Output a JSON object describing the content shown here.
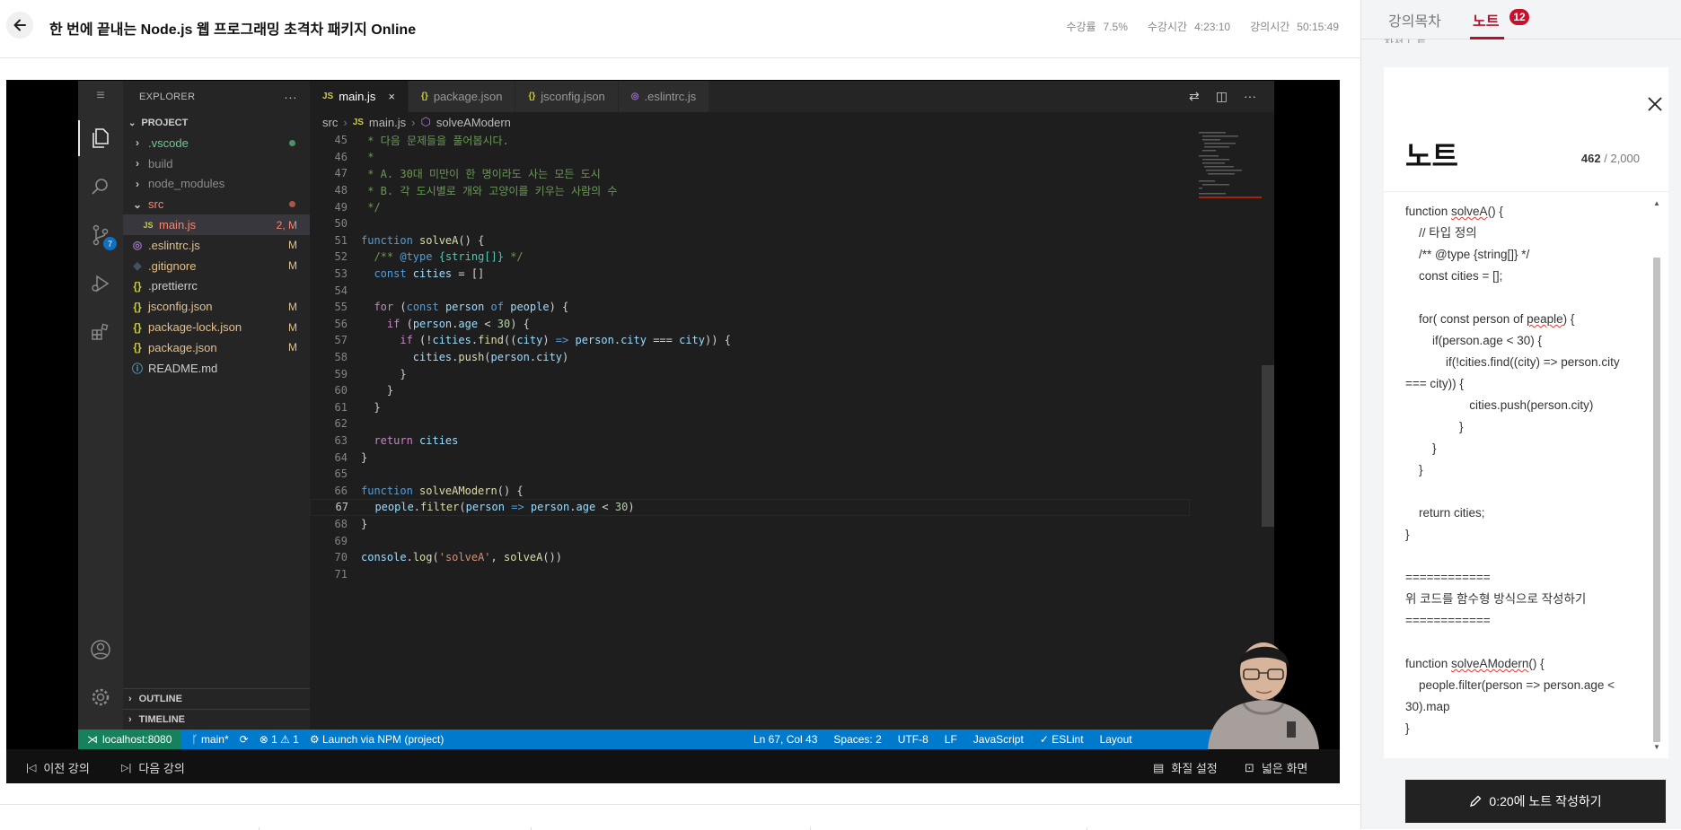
{
  "header": {
    "title": "한 번에 끝내는 Node.js 웹 프로그래밍 초격차 패키지 Online",
    "stats": [
      {
        "label": "수강률",
        "value": "7.5%"
      },
      {
        "label": "수강시간",
        "value": "4:23:10"
      },
      {
        "label": "강의시간",
        "value": "50:15:49"
      }
    ]
  },
  "vscode": {
    "explorer_title": "EXPLORER",
    "explorer_more": "···",
    "project_label": "PROJECT",
    "scm_badge": "7",
    "tree": [
      {
        "name": ".vscode",
        "kind": "folder",
        "indent": 1,
        "color": "#73c991",
        "dot": "#4f8f6a"
      },
      {
        "name": "build",
        "kind": "folder",
        "indent": 1,
        "color": "#8c8c8c"
      },
      {
        "name": "node_modules",
        "kind": "folder",
        "indent": 1,
        "color": "#8c8c8c"
      },
      {
        "name": "src",
        "kind": "folder-open",
        "indent": 1,
        "color": "#f48771",
        "dot": "#a8564a"
      },
      {
        "name": "main.js",
        "kind": "js",
        "indent": 2,
        "color": "#f48771",
        "badge": "2, M",
        "badgeColor": "#f48771",
        "selected": true
      },
      {
        "name": ".eslintrc.js",
        "kind": "eslint",
        "indent": 1,
        "color": "#e2c08d",
        "badge": "M",
        "badgeColor": "#e2c08d"
      },
      {
        "name": ".gitignore",
        "kind": "git",
        "indent": 1,
        "color": "#e2c08d",
        "badge": "M",
        "badgeColor": "#e2c08d"
      },
      {
        "name": ".prettierrc",
        "kind": "json",
        "indent": 1,
        "color": "#cccccc"
      },
      {
        "name": "jsconfig.json",
        "kind": "json",
        "indent": 1,
        "color": "#e2c08d",
        "badge": "M",
        "badgeColor": "#e2c08d"
      },
      {
        "name": "package-lock.json",
        "kind": "json",
        "indent": 1,
        "color": "#e2c08d",
        "badge": "M",
        "badgeColor": "#e2c08d"
      },
      {
        "name": "package.json",
        "kind": "json",
        "indent": 1,
        "color": "#e2c08d",
        "badge": "M",
        "badgeColor": "#e2c08d"
      },
      {
        "name": "README.md",
        "kind": "info",
        "indent": 1,
        "color": "#cccccc"
      }
    ],
    "outline_label": "OUTLINE",
    "timeline_label": "TIMELINE",
    "tabs": [
      {
        "icon": "JS",
        "iconColor": "#cbcb41",
        "label": "main.js",
        "active": true,
        "close": "×"
      },
      {
        "icon": "{}",
        "iconColor": "#cbcb41",
        "label": "package.json"
      },
      {
        "icon": "{}",
        "iconColor": "#cbcb41",
        "label": "jsconfig.json"
      },
      {
        "icon": "◎",
        "iconColor": "#a074c4",
        "label": ".eslintrc.js"
      }
    ],
    "breadcrumb": [
      "src",
      "main.js",
      "solveAModern"
    ],
    "code_lines": [
      {
        "n": 45,
        "segs": [
          [
            "c-com",
            " * 다음 문제들을 풀어봅시다."
          ]
        ]
      },
      {
        "n": 46,
        "segs": [
          [
            "c-com",
            " *"
          ]
        ]
      },
      {
        "n": 47,
        "segs": [
          [
            "c-com",
            " * A. 30대 미만이 한 명이라도 사는 모든 도시"
          ]
        ]
      },
      {
        "n": 48,
        "segs": [
          [
            "c-com",
            " * B. 각 도시별로 개와 고양이를 키우는 사람의 수"
          ]
        ]
      },
      {
        "n": 49,
        "segs": [
          [
            "c-com",
            " */"
          ]
        ]
      },
      {
        "n": 50,
        "segs": []
      },
      {
        "n": 51,
        "segs": [
          [
            "c-kw",
            "function "
          ],
          [
            "c-fn",
            "solveA"
          ],
          [
            "",
            "() {"
          ]
        ]
      },
      {
        "n": 52,
        "segs": [
          [
            "c-com",
            "  /** "
          ],
          [
            "c-kw",
            "@type"
          ],
          [
            "c-com",
            " "
          ],
          [
            "c-typ",
            "{string[]}"
          ],
          [
            "c-com",
            " */"
          ]
        ]
      },
      {
        "n": 53,
        "segs": [
          [
            "c-kw",
            "  const "
          ],
          [
            "c-var",
            "cities"
          ],
          [
            "",
            " = []"
          ]
        ]
      },
      {
        "n": 54,
        "segs": []
      },
      {
        "n": 55,
        "segs": [
          [
            "c-ctl",
            "  for "
          ],
          [
            "",
            "("
          ],
          [
            "c-kw",
            "const "
          ],
          [
            "c-var",
            "person "
          ],
          [
            "c-kw",
            "of "
          ],
          [
            "c-var",
            "people"
          ],
          [
            "",
            ") {"
          ]
        ]
      },
      {
        "n": 56,
        "segs": [
          [
            "c-ctl",
            "    if "
          ],
          [
            "",
            "("
          ],
          [
            "c-var",
            "person"
          ],
          [
            "",
            "."
          ],
          [
            "c-var",
            "age"
          ],
          [
            "",
            " < "
          ],
          [
            "c-num",
            "30"
          ],
          [
            "",
            ") {"
          ]
        ]
      },
      {
        "n": 57,
        "segs": [
          [
            "c-ctl",
            "      if "
          ],
          [
            "",
            "(!"
          ],
          [
            "c-var",
            "cities"
          ],
          [
            "",
            "."
          ],
          [
            "c-fn",
            "find"
          ],
          [
            "",
            "(("
          ],
          [
            "c-var",
            "city"
          ],
          [
            "",
            ") "
          ],
          [
            "c-kw",
            "=>"
          ],
          [
            "",
            " "
          ],
          [
            "c-var",
            "person"
          ],
          [
            "",
            "."
          ],
          [
            "c-var",
            "city"
          ],
          [
            "",
            " === "
          ],
          [
            "c-var",
            "city"
          ],
          [
            "",
            ")) {"
          ]
        ]
      },
      {
        "n": 58,
        "segs": [
          [
            "c-var",
            "        cities"
          ],
          [
            "",
            "."
          ],
          [
            "c-fn",
            "push"
          ],
          [
            "",
            "("
          ],
          [
            "c-var",
            "person"
          ],
          [
            "",
            "."
          ],
          [
            "c-var",
            "city"
          ],
          [
            "",
            ")"
          ]
        ]
      },
      {
        "n": 59,
        "segs": [
          [
            "",
            "      }"
          ]
        ]
      },
      {
        "n": 60,
        "segs": [
          [
            "",
            "    }"
          ]
        ]
      },
      {
        "n": 61,
        "segs": [
          [
            "",
            "  }"
          ]
        ]
      },
      {
        "n": 62,
        "segs": []
      },
      {
        "n": 63,
        "segs": [
          [
            "c-ctl",
            "  return "
          ],
          [
            "c-var",
            "cities"
          ]
        ]
      },
      {
        "n": 64,
        "segs": [
          [
            "",
            "}"
          ]
        ]
      },
      {
        "n": 65,
        "segs": []
      },
      {
        "n": 66,
        "segs": [
          [
            "c-kw",
            "function "
          ],
          [
            "c-fn",
            "solveAModern"
          ],
          [
            "",
            "() {"
          ]
        ]
      },
      {
        "n": 67,
        "segs": [
          [
            "c-var",
            "  people"
          ],
          [
            "",
            "."
          ],
          [
            "c-fn",
            "filter"
          ],
          [
            "",
            "("
          ],
          [
            "c-var",
            "person"
          ],
          [
            "",
            " "
          ],
          [
            "c-kw",
            "=>"
          ],
          [
            "",
            " "
          ],
          [
            "c-var",
            "person"
          ],
          [
            "",
            "."
          ],
          [
            "c-var",
            "age"
          ],
          [
            "",
            " < "
          ],
          [
            "c-num",
            "30"
          ],
          [
            "",
            ")"
          ]
        ],
        "current": true
      },
      {
        "n": 68,
        "segs": [
          [
            "",
            "}"
          ]
        ]
      },
      {
        "n": 69,
        "segs": []
      },
      {
        "n": 70,
        "segs": [
          [
            "c-var",
            "console"
          ],
          [
            "",
            "."
          ],
          [
            "c-fn",
            "log"
          ],
          [
            "",
            "("
          ],
          [
            "c-str",
            "'solveA'"
          ],
          [
            "",
            ", "
          ],
          [
            "c-fn",
            "solveA"
          ],
          [
            "",
            "())"
          ]
        ]
      },
      {
        "n": 71,
        "segs": []
      }
    ],
    "status": {
      "remote": "localhost:8080",
      "branch": "main*",
      "problems": "⊗ 1 ⚠ 1",
      "launch": "Launch via NPM (project)",
      "right": [
        "Ln 67, Col 43",
        "Spaces: 2",
        "UTF-8",
        "LF",
        "JavaScript",
        "✓ ESLint",
        "Layout"
      ]
    }
  },
  "video_controls": {
    "prev": "이전 강의",
    "next": "다음 강의",
    "quality": "화질 설정",
    "wide": "넓은 화면"
  },
  "panel": {
    "tab_toc": "강의목차",
    "tab_note": "노트",
    "note_badge": "12",
    "hint": "작성 노트",
    "note_title": "노트",
    "count_current": "462",
    "count_max": "/ 2,000",
    "note_lines": [
      "function solveA() {",
      "    // 타입 정의",
      "    /** @type {string[]} */",
      "    const cities = [];",
      "",
      "    for( const person of peaple) {",
      "        if(person.age < 30) {",
      "            if(!cities.find((city) => person.city",
      "=== city)) {",
      "                   cities.push(person.city)",
      "                }",
      "        }",
      "    }",
      "",
      "    return cities;",
      "}",
      "",
      "============",
      "위 코드를 함수형 방식으로 작성하기",
      "============",
      "",
      "function solveAModern() {",
      "    people.filter(person => person.age <",
      "30).map",
      "}"
    ],
    "write_button": "0:20에 노트 작성하기"
  }
}
